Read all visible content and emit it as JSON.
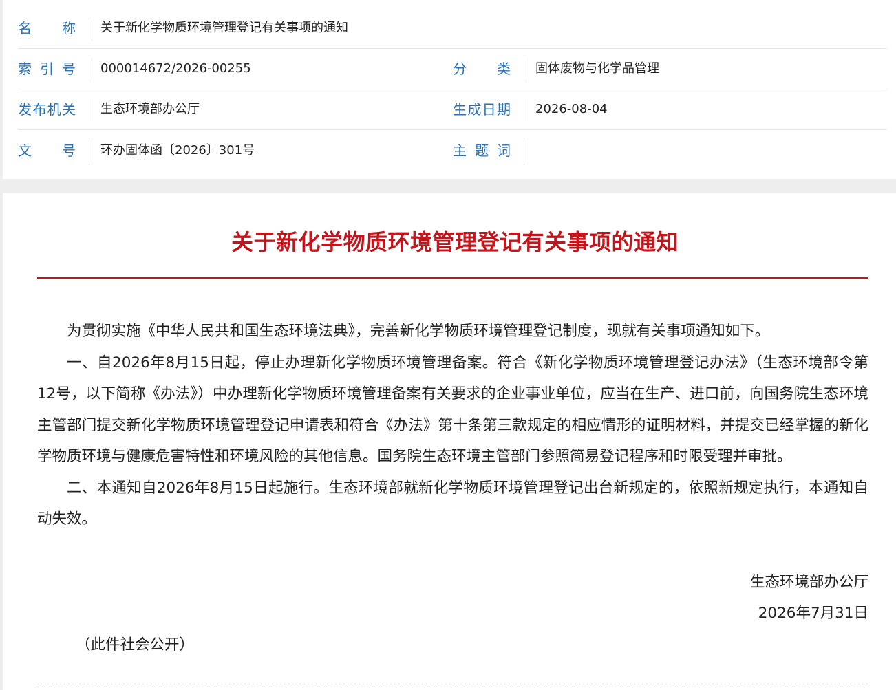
{
  "meta": {
    "name_label": "名称",
    "name_value": "关于新化学物质环境管理登记有关事项的通知",
    "index_label": "索引号",
    "index_value": "000014672/2026-00255",
    "category_label": "分类",
    "category_value": "固体废物与化学品管理",
    "issuer_label": "发布机关",
    "issuer_value": "生态环境部办公厅",
    "date_label": "生成日期",
    "date_value": "2026-08-04",
    "docno_label": "文号",
    "docno_value": "环办固体函〔2026〕301号",
    "topic_label": "主题词",
    "topic_value": ""
  },
  "article": {
    "title": "关于新化学物质环境管理登记有关事项的通知",
    "paragraphs": [
      "为贯彻实施《中华人民共和国生态环境法典》，完善新化学物质环境管理登记制度，现就有关事项通知如下。",
      "一、自2026年8月15日起，停止办理新化学物质环境管理备案。符合《新化学物质环境管理登记办法》（生态环境部令第12号，以下简称《办法》）中办理新化学物质环境管理备案有关要求的企业事业单位，应当在生产、进口前，向国务院生态环境主管部门提交新化学物质环境管理登记申请表和符合《办法》第十条第三款规定的相应情形的证明材料，并提交已经掌握的新化学物质环境与健康危害特性和环境风险的其他信息。国务院生态环境主管部门参照简易登记程序和时限受理并审批。",
      "二、本通知自2026年8月15日起施行。生态环境部就新化学物质环境管理登记出台新规定的，依照新规定执行，本通知自动失效。"
    ],
    "signer": "生态环境部办公厅",
    "sign_date": "2026年7月31日",
    "public_note": "（此件社会公开）"
  },
  "colors": {
    "label_blue": "#2a72b5",
    "title_red": "#c3161c"
  }
}
